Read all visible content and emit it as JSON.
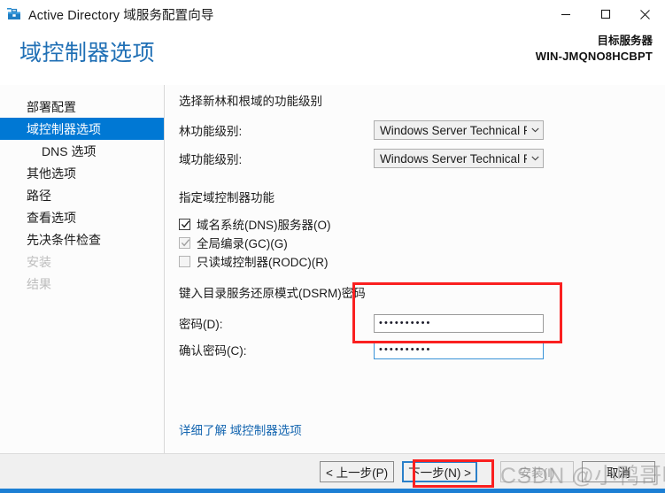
{
  "window": {
    "title": "Active Directory 域服务配置向导",
    "icon": "ad-wizard-icon",
    "controls": {
      "minimize": "minimize-icon",
      "maximize": "maximize-icon",
      "close": "close-icon"
    }
  },
  "header": {
    "page_title": "域控制器选项",
    "target_server_label": "目标服务器",
    "target_server_name": "WIN-JMQNO8HCBPT"
  },
  "sidebar": {
    "items": [
      {
        "label": "部署配置",
        "state": "normal",
        "indent": false
      },
      {
        "label": "域控制器选项",
        "state": "selected",
        "indent": false
      },
      {
        "label": "DNS 选项",
        "state": "normal",
        "indent": true
      },
      {
        "label": "其他选项",
        "state": "normal",
        "indent": false
      },
      {
        "label": "路径",
        "state": "normal",
        "indent": false
      },
      {
        "label": "查看选项",
        "state": "normal",
        "indent": false
      },
      {
        "label": "先决条件检查",
        "state": "normal",
        "indent": false
      },
      {
        "label": "安装",
        "state": "disabled",
        "indent": false
      },
      {
        "label": "结果",
        "state": "disabled",
        "indent": false
      }
    ]
  },
  "main": {
    "functional_level": {
      "section_title": "选择新林和根域的功能级别",
      "forest_label": "林功能级别:",
      "forest_value": "Windows Server Technical Pre",
      "domain_label": "域功能级别:",
      "domain_value": "Windows Server Technical Pre"
    },
    "capabilities": {
      "section_title": "指定域控制器功能",
      "items": [
        {
          "label": "域名系统(DNS)服务器(O)",
          "checked": true,
          "enabled": true
        },
        {
          "label": "全局编录(GC)(G)",
          "checked": true,
          "enabled": false
        },
        {
          "label": "只读域控制器(RODC)(R)",
          "checked": false,
          "enabled": false
        }
      ]
    },
    "dsrm": {
      "section_title": "键入目录服务还原模式(DSRM)密码",
      "password_label": "密码(D):",
      "password_value": "••••••••••",
      "confirm_label": "确认密码(C):",
      "confirm_value": "••••••••••"
    },
    "learn_more": "详细了解 域控制器选项"
  },
  "footer": {
    "back_label": "< 上一步(P)",
    "next_label": "下一步(N) >",
    "install_label": "安装(I)",
    "cancel_label": "取消"
  },
  "watermark": {
    "text": "CSDN @小鸭哥呀"
  },
  "colors": {
    "accent": "#0078d4",
    "title_blue": "#1f6fb5",
    "link_blue": "#1566b0",
    "annotation_red": "#fa2020",
    "taskbar_blue": "#1c7fd4"
  }
}
